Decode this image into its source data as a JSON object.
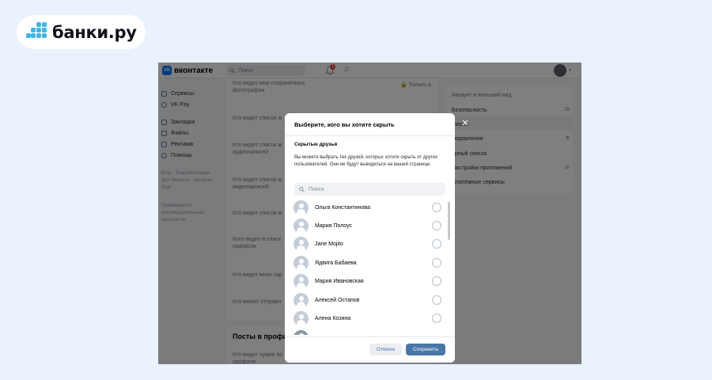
{
  "brand": {
    "logo_text": "банки.ру",
    "accent": "#41b6e6"
  },
  "vk": {
    "logo_text": "вконтакте",
    "search_placeholder": "Поиск",
    "notifications_count": "1",
    "nav": [
      "Сервисы",
      "VK Pay",
      "Закладки",
      "Файлы",
      "Реклама",
      "Помощь"
    ],
    "footer_links": [
      "Блог",
      "Разработчикам",
      "Для бизнеса",
      "Авторам",
      "Ещё"
    ],
    "footer_note": "Применяются рекомендательные технологии",
    "privacy_rows": [
      "Кто видит мои сохранённые фотографии",
      "Кто видит список м",
      "Кто видит список м аудиозаписей",
      "Кто видит список м видеозаписей",
      "Кто видит список м",
      "Кого видно в списк подписок",
      "Кто видит моих скр",
      "Кто может отправл"
    ],
    "only_me": "Только я",
    "posts_title": "Посты в профил",
    "posts_row": "Кто видит чужие по профиле",
    "settings_menu": [
      {
        "label": "Аккаунт и внешний вид",
        "badge": ""
      },
      {
        "label": "Безопасность",
        "badge": "ID"
      },
      {
        "label": "тность",
        "badge": ""
      },
      {
        "label": "ведомления",
        "badge": "⚙"
      },
      {
        "label": "ёрный список",
        "badge": ""
      },
      {
        "label": "Настройки приложений",
        "badge": "ID"
      },
      {
        "label": "Платёжные сервисы",
        "badge": ""
      }
    ]
  },
  "modal": {
    "title": "Выберите, кого вы хотите скрыть",
    "subtitle": "Скрытые друзья",
    "description": "Вы можете выбрать тех друзей, которых хотите скрыть от других пользователей. Они не будут выводиться на вашей странице.",
    "search_placeholder": "Поиск",
    "friends": [
      "Ольга Константинова",
      "Мария Полоус",
      "Jane Mojito",
      "Ядвига Бабаева",
      "Мария Ивановская",
      "Алексей Остапов",
      "Алена Козина"
    ],
    "cancel_label": "Отмена",
    "save_label": "Сохранить",
    "close_icon": "close-icon"
  }
}
